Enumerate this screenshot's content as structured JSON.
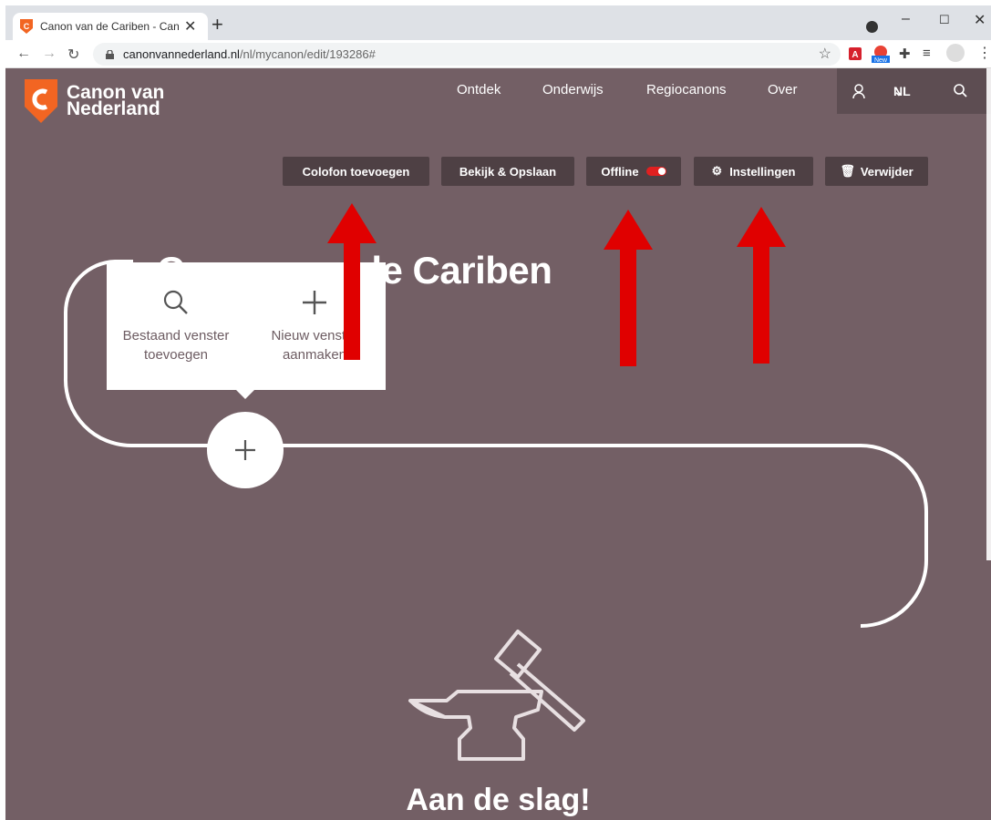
{
  "browser": {
    "tab_title": "Canon van de Cariben - Canon v",
    "url_host": "canonvannederland.nl",
    "url_path": "/nl/mycanon/edit/193286#"
  },
  "nav": {
    "logo_line1": "Canon van",
    "logo_line2": "Nederland",
    "items": [
      "Ontdek",
      "Onderwijs",
      "Regiocanons",
      "Over"
    ],
    "lang": "NL"
  },
  "actions": {
    "colofon": "Colofon toevoegen",
    "bekijk": "Bekijk & Opslaan",
    "offline": "Offline",
    "instellingen": "Instellingen",
    "verwijder": "Verwijder"
  },
  "canon_title": "Canon van de Cariben",
  "popup": {
    "existing_line1": "Bestaand venster",
    "existing_line2": "toevoegen",
    "new_line1": "Nieuw venster",
    "new_line2": "aanmaken"
  },
  "cta": "Aan de slag!",
  "colors": {
    "page_bg": "#735f65",
    "button_bg": "#4e4044",
    "brand_orange": "#f26522",
    "arrow_red": "#e00000"
  }
}
